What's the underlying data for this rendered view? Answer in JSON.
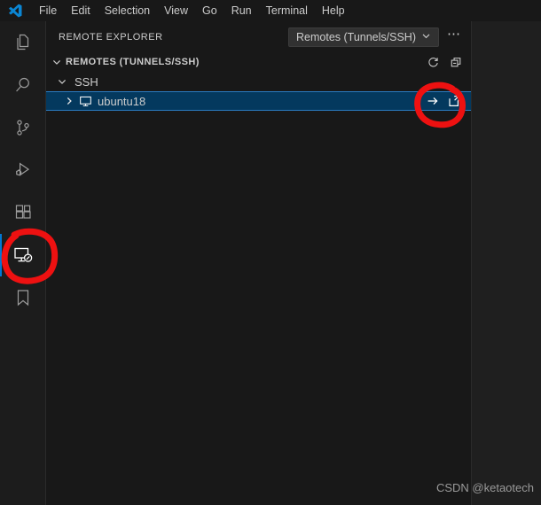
{
  "titlebar": {
    "logo_icon": "vscode-logo-icon",
    "menu": [
      {
        "label": "File"
      },
      {
        "label": "Edit"
      },
      {
        "label": "Selection"
      },
      {
        "label": "View"
      },
      {
        "label": "Go"
      },
      {
        "label": "Run"
      },
      {
        "label": "Terminal"
      },
      {
        "label": "Help"
      }
    ]
  },
  "activitybar": {
    "items": [
      {
        "name": "explorer",
        "icon": "files-icon",
        "active": false
      },
      {
        "name": "search",
        "icon": "search-icon",
        "active": false
      },
      {
        "name": "source-control",
        "icon": "source-control-icon",
        "active": false
      },
      {
        "name": "run-and-debug",
        "icon": "run-and-debug-icon",
        "active": false
      },
      {
        "name": "extensions",
        "icon": "extensions-icon",
        "active": false
      },
      {
        "name": "remote-explorer",
        "icon": "remote-explorer-icon",
        "active": true
      },
      {
        "name": "bookmarks",
        "icon": "bookmark-icon",
        "active": false
      }
    ]
  },
  "sidebar": {
    "pane_title": "REMOTE EXPLORER",
    "remote_select": {
      "value": "Remotes (Tunnels/SSH)",
      "chevron_icon": "chevron-down-icon"
    },
    "more_actions_label": "⋯",
    "section": {
      "title": "REMOTES (TUNNELS/SSH)",
      "twisty_icon": "chevron-down-icon",
      "actions": [
        {
          "name": "refresh",
          "icon": "refresh-icon"
        },
        {
          "name": "collapse-all",
          "icon": "collapse-all-icon"
        }
      ]
    },
    "tree": [
      {
        "label": "SSH",
        "icon": "none",
        "twisty": "chevron-down-icon",
        "level": 1,
        "selected": false,
        "expanded": true
      },
      {
        "label": "ubuntu18",
        "icon": "desktop-icon",
        "twisty": "chevron-right-icon",
        "level": 2,
        "selected": true,
        "expanded": false,
        "actions": [
          {
            "name": "connect-in-current-window",
            "icon": "arrow-right-icon"
          },
          {
            "name": "connect-in-new-window",
            "icon": "new-window-icon"
          }
        ]
      }
    ]
  },
  "editor": {
    "watermark": "CSDN @ketaotech"
  },
  "annotations": [
    {
      "name": "highlight-connect-buttons",
      "shape": "circle",
      "color": "#ee1111"
    },
    {
      "name": "highlight-remote-explorer-icon",
      "shape": "circle",
      "color": "#ee1111"
    }
  ],
  "colors": {
    "titlebar_bg": "#181818",
    "activitybar_bg": "#1c1c1c",
    "sidebar_bg": "#181818",
    "editor_bg": "#1f1f1f",
    "selection_bg": "#04395e",
    "selection_border": "#2a7bc0",
    "active_indicator": "#0078d4",
    "text": "#cccccc",
    "annotation": "#ee1111"
  }
}
